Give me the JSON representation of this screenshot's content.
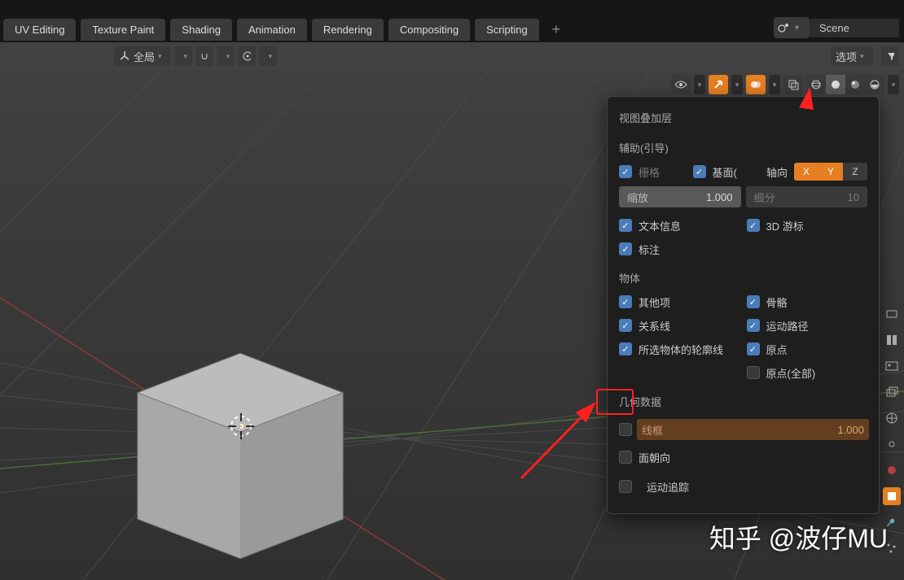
{
  "tabs": [
    "UV Editing",
    "Texture Paint",
    "Shading",
    "Animation",
    "Rendering",
    "Compositing",
    "Scripting"
  ],
  "scene_label": "Scene",
  "orientation": "全局",
  "options_label": "选项",
  "popover": {
    "title": "视图叠加层",
    "guides_header": "辅助(引导)",
    "grid": "栅格",
    "floor": "基面(",
    "axis_label": "轴向",
    "axes": [
      "X",
      "Y",
      "Z"
    ],
    "scale_label": "缩放",
    "scale_value": "1.000",
    "subdiv_label": "细分",
    "subdiv_value": "10",
    "text_info": "文本信息",
    "cursor3d": "3D 游标",
    "annotations": "标注",
    "objects_header": "物体",
    "extras": "其他项",
    "bones": "骨骼",
    "relationships": "关系线",
    "motion_paths": "运动路径",
    "outline_selected": "所选物体的轮廓线",
    "origins": "原点",
    "origins_all": "原点(全部)",
    "geometry_header": "几何数据",
    "wireframe": "线框",
    "wireframe_value": "1.000",
    "face_orientation": "面朝向",
    "motion_tracking": "运动追踪"
  },
  "watermark": "知乎 @波仔MU"
}
